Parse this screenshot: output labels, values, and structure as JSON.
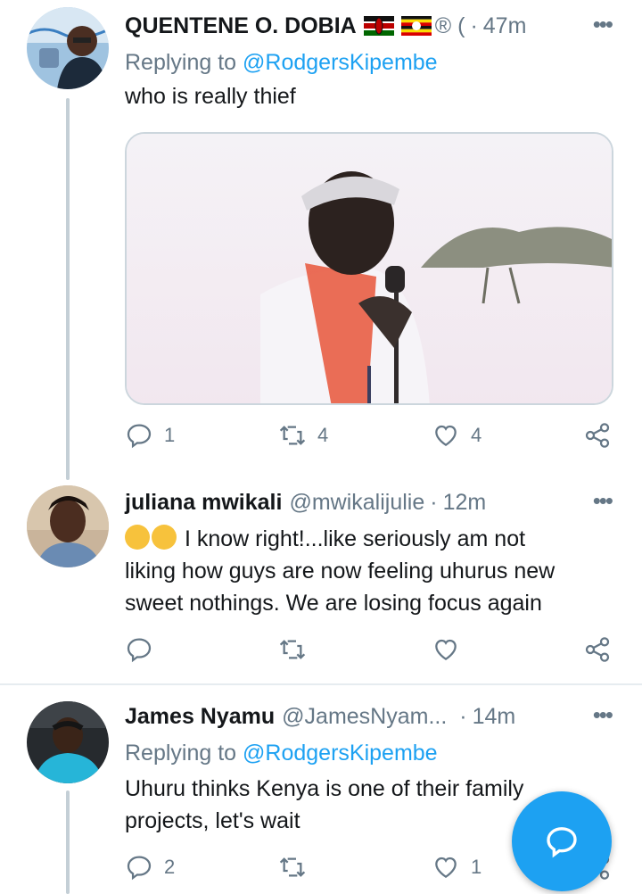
{
  "tweets": [
    {
      "name": "QUENTENE O. DOBIA",
      "name_suffix": "® (",
      "time": "47m",
      "replying_prefix": "Replying to",
      "replying_handle": "@RodgersKipembe",
      "text": "who is really thief",
      "counts": {
        "reply": "1",
        "retweet": "4",
        "like": "4"
      }
    },
    {
      "name": "juliana mwikali",
      "handle": "@mwikalijulie",
      "time": "12m",
      "text_line1": " I know right!...like seriously am not",
      "text_line2": "liking how guys are now feeling uhurus new",
      "text_line3": "sweet nothings.  We are losing focus again"
    },
    {
      "name": "James Nyamu",
      "handle": "@JamesNyam...",
      "time": "14m",
      "replying_prefix": "Replying to",
      "replying_handle": "@RodgersKipembe",
      "text_line1": "Uhuru thinks Kenya is one of their family",
      "text_line2": "projects, let's wait",
      "counts": {
        "reply": "2",
        "like": "1"
      }
    }
  ],
  "ui": {
    "dot": "·",
    "more": "•••"
  },
  "colors": {
    "accent": "#1da1f2",
    "secondary_text": "#657786",
    "divider": "#e6ecf0"
  },
  "icons": [
    "reply-icon",
    "retweet-icon",
    "like-icon",
    "share-icon",
    "compose-reply-icon"
  ]
}
